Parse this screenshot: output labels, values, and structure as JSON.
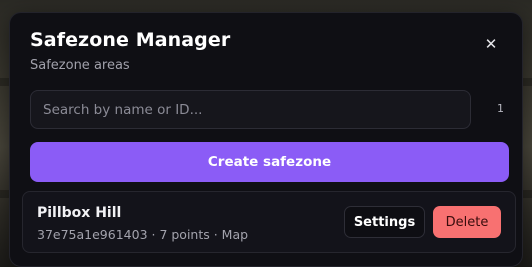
{
  "panel": {
    "title": "Safezone Manager",
    "subtitle": "Safezone areas",
    "close_icon": "close-icon",
    "close_glyph": "✕"
  },
  "search": {
    "placeholder": "Search by name or ID...",
    "value": "",
    "count": "1"
  },
  "create_button": {
    "label": "Create safezone"
  },
  "safezones": [
    {
      "name": "Pillbox Hill",
      "meta": "37e75a1e961403 · 7 points · Map",
      "settings_label": "Settings",
      "delete_label": "Delete"
    }
  ],
  "colors": {
    "accent": "#8b5cf6",
    "danger": "#f87171",
    "panel_bg": "#0f0f14"
  }
}
